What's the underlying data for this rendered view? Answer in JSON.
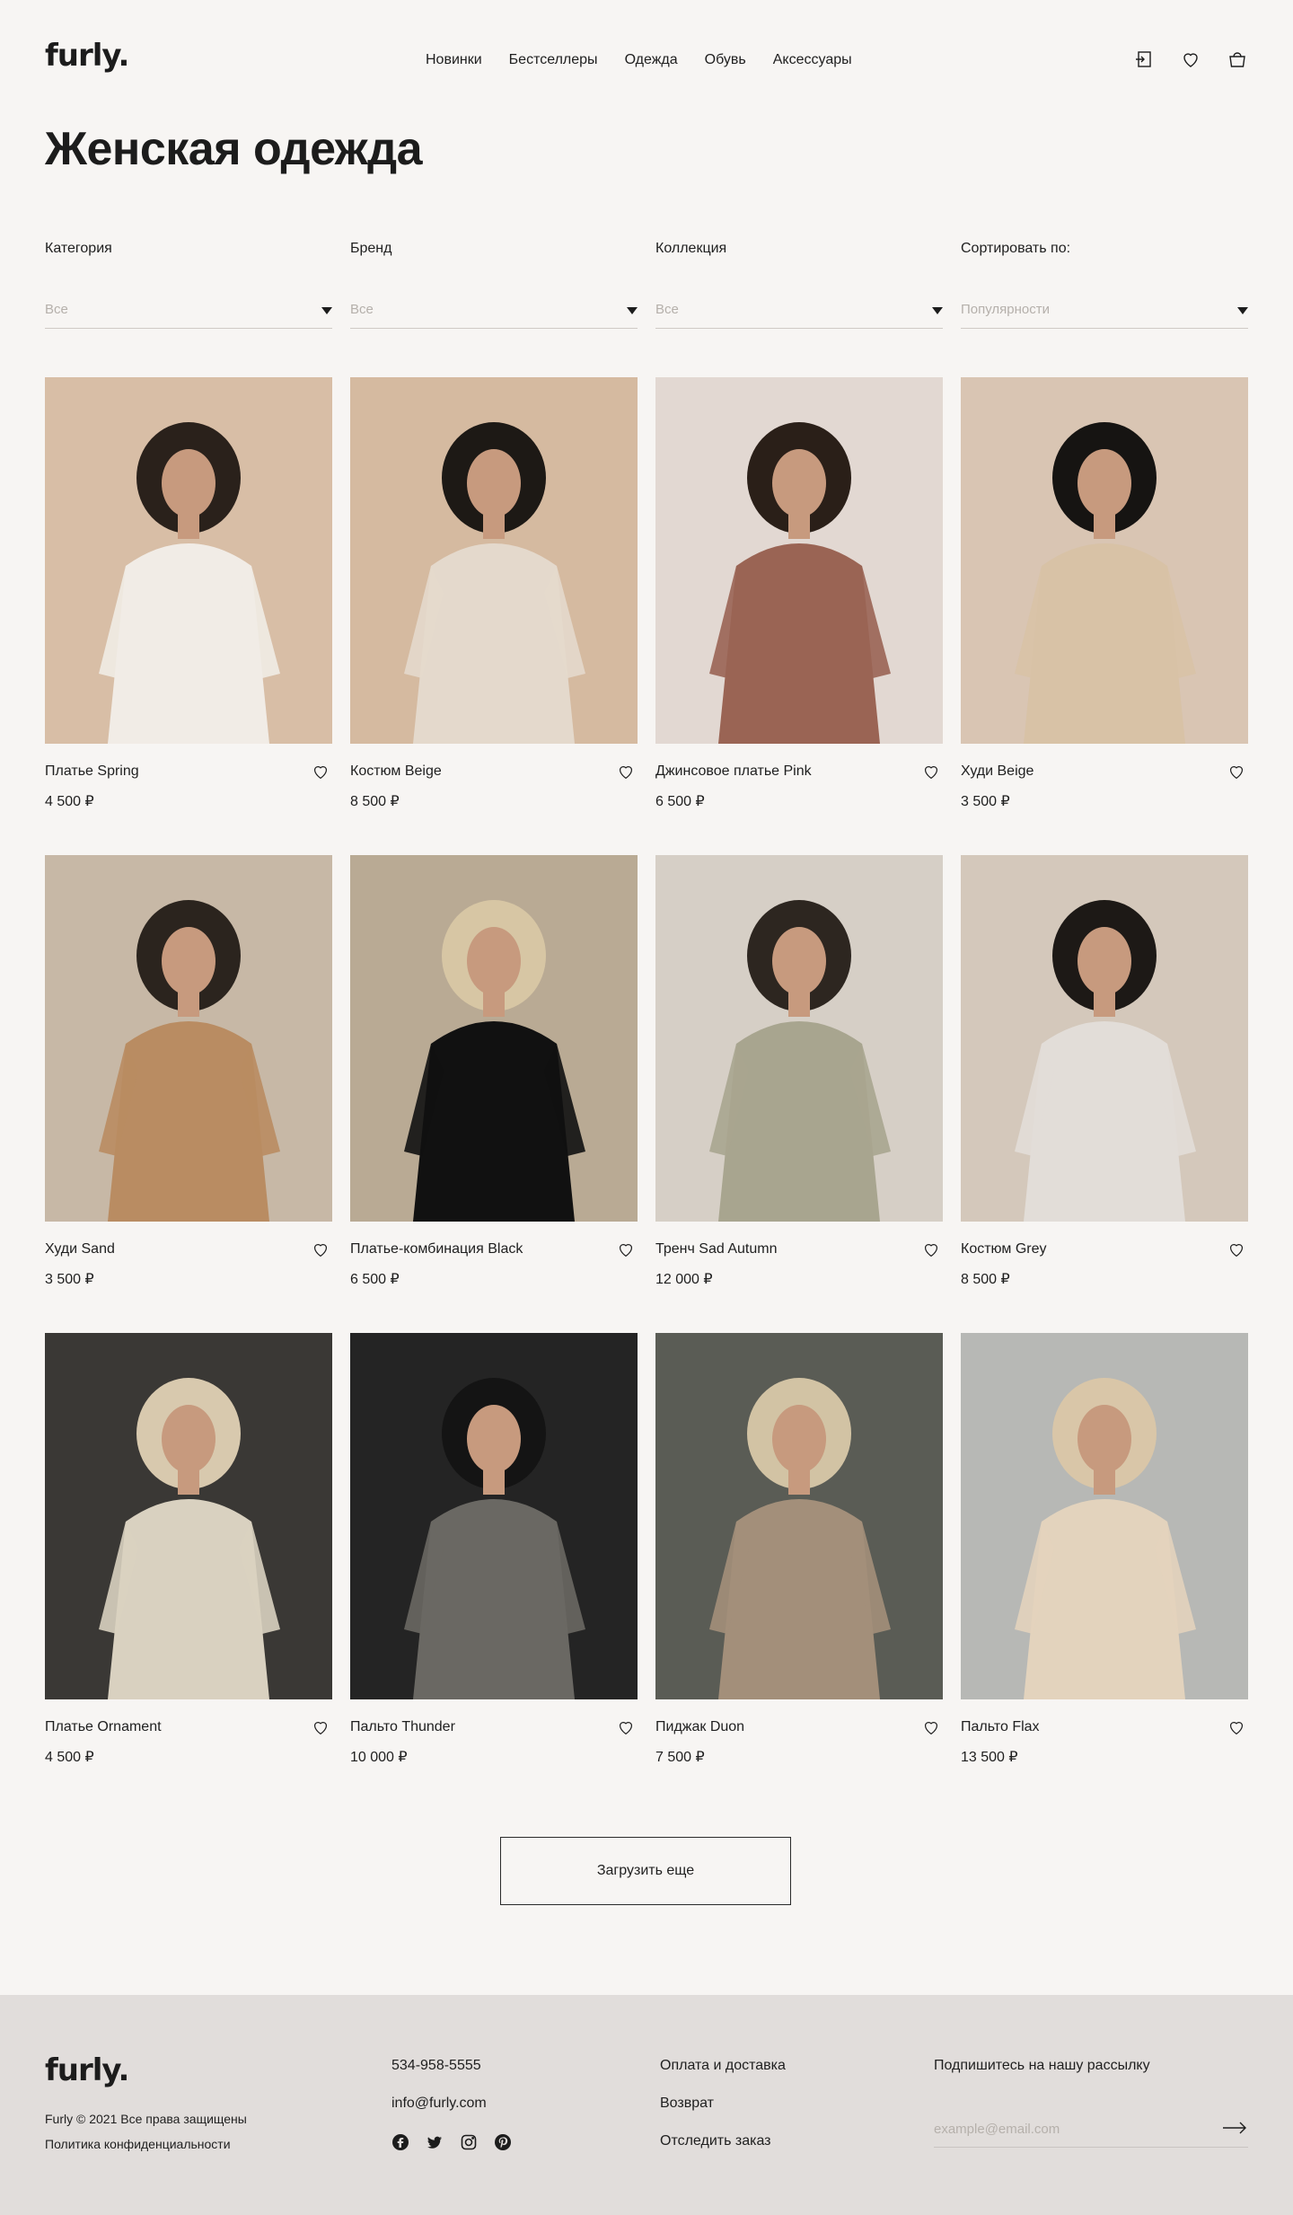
{
  "header": {
    "logo": "furly.",
    "nav": [
      "Новинки",
      "Бестселлеры",
      "Одежда",
      "Обувь",
      "Аксессуары"
    ],
    "icons": [
      "login-icon",
      "heart-icon",
      "bag-icon"
    ]
  },
  "page_title": "Женская одежда",
  "filters": [
    {
      "label": "Категория",
      "value": "Все"
    },
    {
      "label": "Бренд",
      "value": "Все"
    },
    {
      "label": "Коллекция",
      "value": "Все"
    },
    {
      "label": "Сортировать по:",
      "value": "Популярности"
    }
  ],
  "products": [
    {
      "name": "Платье Spring",
      "price": "4 500 ₽",
      "bg": "#d8bea6",
      "fg": "#f1ece6",
      "hair": "#2a211b"
    },
    {
      "name": "Костюм Beige",
      "price": "8 500 ₽",
      "bg": "#d5baa0",
      "fg": "#e4d9cc",
      "hair": "#1d1915"
    },
    {
      "name": "Джинсовое платье Pink",
      "price": "6 500 ₽",
      "bg": "#e2d8d2",
      "fg": "#9a6454",
      "hair": "#2a1f18"
    },
    {
      "name": "Худи Beige",
      "price": "3 500 ₽",
      "bg": "#d9c5b3",
      "fg": "#d8c2a6",
      "hair": "#161412"
    },
    {
      "name": "Худи Sand",
      "price": "3 500 ₽",
      "bg": "#c7b8a6",
      "fg": "#b98c62",
      "hair": "#2b241e"
    },
    {
      "name": "Платье-комбинация Black",
      "price": "6 500 ₽",
      "bg": "#b9aa94",
      "fg": "#111111",
      "hair": "#d7c6a4"
    },
    {
      "name": "Тренч Sad Autumn",
      "price": "12 000 ₽",
      "bg": "#d6cfc6",
      "fg": "#a8a58f",
      "hair": "#2d2620"
    },
    {
      "name": "Костюм Grey",
      "price": "8 500 ₽",
      "bg": "#d4c8bb",
      "fg": "#e2ddd8",
      "hair": "#1d1916"
    },
    {
      "name": "Платье Ornament",
      "price": "4 500 ₽",
      "bg": "#3a3835",
      "fg": "#d9d1c0",
      "hair": "#d8c9ae"
    },
    {
      "name": "Пальто Thunder",
      "price": "10 000 ₽",
      "bg": "#242424",
      "fg": "#6a6863",
      "hair": "#141414"
    },
    {
      "name": "Пиджак Duon",
      "price": "7 500 ₽",
      "bg": "#5a5c55",
      "fg": "#a38f7a",
      "hair": "#d2c3a4"
    },
    {
      "name": "Пальто Flax",
      "price": "13 500 ₽",
      "bg": "#b7b8b5",
      "fg": "#e3d3bd",
      "hair": "#d9c6a8"
    }
  ],
  "load_more": "Загрузить еще",
  "footer": {
    "logo": "furly.",
    "copyright": "Furly © 2021 Все права защищены",
    "policy": "Политика конфиденциальности",
    "phone": "534-958-5555",
    "email": "info@furly.com",
    "social_icons": [
      "facebook-icon",
      "twitter-icon",
      "instagram-icon",
      "pinterest-icon"
    ],
    "links": [
      "Оплата и доставка",
      "Возврат",
      "Отследить заказ"
    ],
    "newsletter_title": "Подпишитесь на нашу рассылку",
    "newsletter_placeholder": "example@email.com"
  }
}
